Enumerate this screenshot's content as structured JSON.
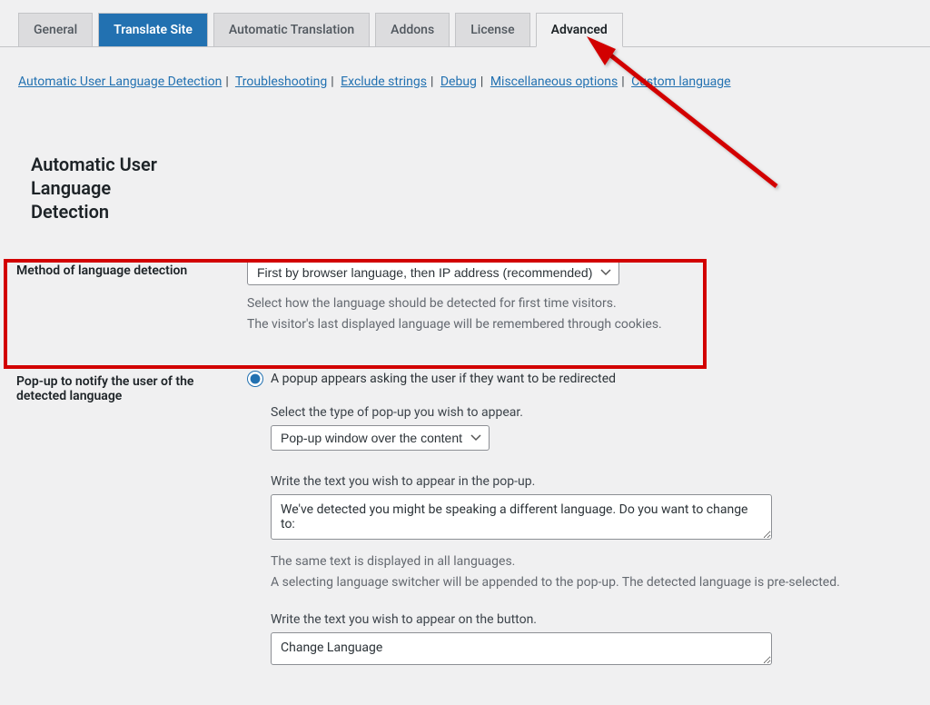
{
  "tabs": [
    {
      "label": "General"
    },
    {
      "label": "Translate Site"
    },
    {
      "label": "Automatic Translation"
    },
    {
      "label": "Addons"
    },
    {
      "label": "License"
    },
    {
      "label": "Advanced"
    }
  ],
  "sublinks": [
    "Automatic User Language Detection",
    "Troubleshooting",
    "Exclude strings",
    "Debug",
    "Miscellaneous options",
    "Custom language"
  ],
  "section_title": "Automatic User Language Detection",
  "method": {
    "label": "Method of language detection",
    "select_value": "First by browser language, then IP address (recommended)",
    "help1": "Select how the language should be detected for first time visitors.",
    "help2": "The visitor's last displayed language will be remembered through cookies."
  },
  "popup": {
    "label": "Pop-up to notify the user of the detected language",
    "radio_label": "A popup appears asking the user if they want to be redirected",
    "type_label": "Select the type of pop-up you wish to appear.",
    "type_value": "Pop-up window over the content",
    "text_label": "Write the text you wish to appear in the pop-up.",
    "text_value": "We've detected you might be speaking a different language. Do you want to change to:",
    "text_help1": "The same text is displayed in all languages.",
    "text_help2": "A selecting language switcher will be appended to the pop-up. The detected language is pre-selected.",
    "button_label": "Write the text you wish to appear on the button.",
    "button_value": "Change Language"
  }
}
